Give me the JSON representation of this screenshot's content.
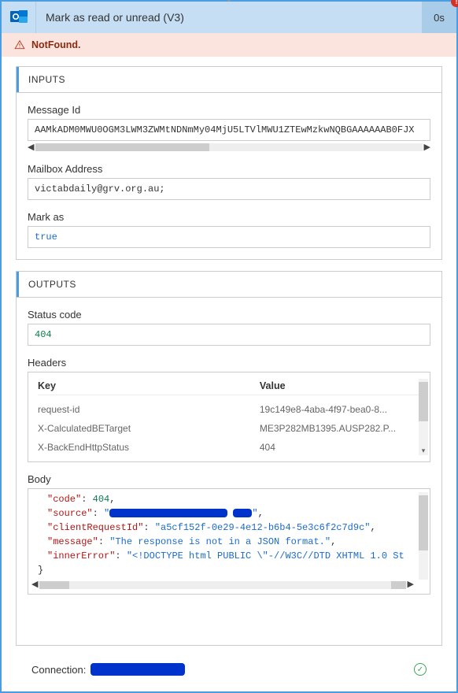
{
  "header": {
    "title": "Mark as read or unread (V3)",
    "duration": "0s",
    "hasError": true
  },
  "error": {
    "text": "NotFound."
  },
  "inputs": {
    "heading": "INPUTS",
    "messageId": {
      "label": "Message Id",
      "value": "AAMkADM0MWU0OGM3LWM3ZWMtNDNmMy04MjU5LTVlMWU1ZTEwMzkwNQBGAAAAAAB0FJX"
    },
    "mailbox": {
      "label": "Mailbox Address",
      "value": "victabdaily@grv.org.au;"
    },
    "markAs": {
      "label": "Mark as",
      "value": "true"
    }
  },
  "outputs": {
    "heading": "OUTPUTS",
    "status": {
      "label": "Status code",
      "value": "404"
    },
    "headers": {
      "label": "Headers",
      "cols": {
        "key": "Key",
        "value": "Value"
      },
      "rows": [
        {
          "key": "request-id",
          "value": "19c149e8-4aba-4f97-bea0-8..."
        },
        {
          "key": "X-CalculatedBETarget",
          "value": "ME3P282MB1395.AUSP282.P..."
        },
        {
          "key": "X-BackEndHttpStatus",
          "value": "404"
        }
      ]
    },
    "body": {
      "label": "Body",
      "lines": {
        "codeKey": "\"code\"",
        "codeVal": "404",
        "sourceKey": "\"source\"",
        "clientKey": "\"clientRequestId\"",
        "clientVal": "\"a5cf152f-0e29-4e12-b6b4-5e3c6f2c7d9c\"",
        "msgKey": "\"message\"",
        "msgVal": "\"The response is not in a JSON format.\"",
        "innerKey": "\"innerError\"",
        "innerVal": "\"<!DOCTYPE html PUBLIC \\\"-//W3C//DTD XHTML 1.0 St"
      }
    }
  },
  "footer": {
    "label": "Connection:"
  }
}
